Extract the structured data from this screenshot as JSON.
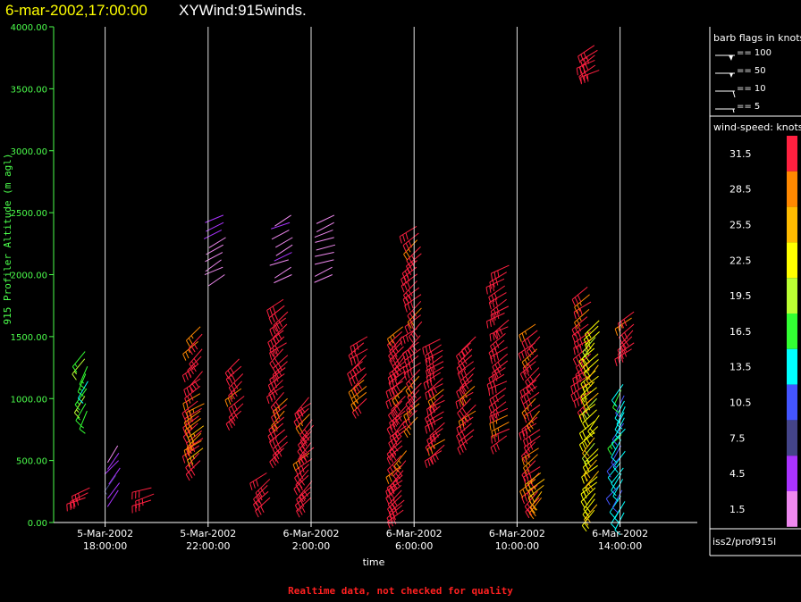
{
  "header": {
    "date": "6-mar-2002,17:00:00",
    "title": "XYWind:915winds."
  },
  "footer": {
    "note": "Realtime data, not checked for quality",
    "source": "iss2/prof915l"
  },
  "colors": {
    "background": "#000000",
    "axis_green": "#4cff4c",
    "title_yellow": "#ffff00",
    "note_red": "#ff2020",
    "gridline": "#e0e0e0"
  },
  "legend": {
    "barb_title": "barb flags in knots",
    "barbs": [
      {
        "label": "== 100"
      },
      {
        "label": "== 50"
      },
      {
        "label": "== 10"
      },
      {
        "label": "== 5"
      }
    ],
    "speed_title": "wind-speed: knots",
    "speed_levels": [
      {
        "value": "31.5",
        "color": "#ff2040"
      },
      {
        "value": "28.5",
        "color": "#ff8800"
      },
      {
        "value": "25.5",
        "color": "#ffbb00"
      },
      {
        "value": "22.5",
        "color": "#ffff00"
      },
      {
        "value": "19.5",
        "color": "#bbff33"
      },
      {
        "value": "16.5",
        "color": "#33ff33"
      },
      {
        "value": "13.5",
        "color": "#00ffff"
      },
      {
        "value": "10.5",
        "color": "#4455ff"
      },
      {
        "value": "7.5",
        "color": "#444488"
      },
      {
        "value": "4.5",
        "color": "#aa33ff"
      },
      {
        "value": "1.5",
        "color": "#ee88ee"
      }
    ]
  },
  "chart_data": {
    "type": "scatter",
    "title": "XYWind:915winds.",
    "xlabel": "time",
    "ylabel": "915 Profiler Altitude (m agl)",
    "ylim": [
      0,
      4000
    ],
    "xlim_hours_label": "5-Mar-2002 16:00 to 6-Mar-2002 17:00",
    "yticks": [
      "0.00",
      "500.00",
      "1000.00",
      "1500.00",
      "2000.00",
      "2500.00",
      "3000.00",
      "3500.00",
      "4000.00"
    ],
    "xticks": [
      {
        "date": "5-Mar-2002",
        "time": "18:00:00"
      },
      {
        "date": "5-Mar-2002",
        "time": "22:00:00"
      },
      {
        "date": "6-Mar-2002",
        "time": "2:00:00"
      },
      {
        "date": "6-Mar-2002",
        "time": "6:00:00"
      },
      {
        "date": "6-Mar-2002",
        "time": "10:00:00"
      },
      {
        "date": "6-Mar-2002",
        "time": "14:00:00"
      }
    ],
    "grid": "vertical lines at each x tick",
    "legend": "right",
    "series_note": "wind barbs colored by wind speed (knots)",
    "columns": [
      {
        "t": 17.3,
        "alts": [
          900,
          1380,
          60
        ],
        "speed": 16.5,
        "dir": 210
      },
      {
        "t": 17.3,
        "alts": [
          200,
          280,
          40
        ],
        "speed": 31.5,
        "dir": 250
      },
      {
        "t": 18.5,
        "alts": [
          260,
          640,
          60
        ],
        "speed": 4.5,
        "dir": 220
      },
      {
        "t": 19.8,
        "alts": [
          180,
          280,
          50
        ],
        "speed": 31.5,
        "dir": 250
      },
      {
        "t": 21.7,
        "alts": [
          500,
          1600,
          60
        ],
        "speed": 31.5,
        "dir": 230
      },
      {
        "t": 21.8,
        "alts": [
          600,
          1000,
          60
        ],
        "speed": 28.5,
        "dir": 235
      },
      {
        "t": 22.6,
        "alts": [
          2000,
          2520,
          60
        ],
        "speed": 1.5,
        "dir": 240
      },
      {
        "t": 23.3,
        "alts": [
          900,
          1350,
          60
        ],
        "speed": 31.5,
        "dir": 225
      },
      {
        "t": 24.3,
        "alts": [
          200,
          440,
          50
        ],
        "speed": 31.5,
        "dir": 235
      },
      {
        "t": 25.0,
        "alts": [
          600,
          1800,
          50
        ],
        "speed": 31.5,
        "dir": 230
      },
      {
        "t": 25.2,
        "alts": [
          2000,
          2480,
          60
        ],
        "speed": 1.5,
        "dir": 245
      },
      {
        "t": 26.0,
        "alts": [
          200,
          1030,
          45
        ],
        "speed": 31.5,
        "dir": 228
      },
      {
        "t": 26.9,
        "alts": [
          2000,
          2520,
          60
        ],
        "speed": 1.5,
        "dir": 250
      },
      {
        "t": 28.1,
        "alts": [
          1000,
          1520,
          50
        ],
        "speed": 31.5,
        "dir": 232
      },
      {
        "t": 29.6,
        "alts": [
          100,
          1600,
          40
        ],
        "speed": 31.5,
        "dir": 228
      },
      {
        "t": 30.2,
        "alts": [
          850,
          2400,
          55
        ],
        "speed": 31.5,
        "dir": 230
      },
      {
        "t": 31.1,
        "alts": [
          580,
          1500,
          45
        ],
        "speed": 31.5,
        "dir": 235
      },
      {
        "t": 32.3,
        "alts": [
          700,
          1520,
          50
        ],
        "speed": 31.5,
        "dir": 232
      },
      {
        "t": 33.6,
        "alts": [
          700,
          2100,
          55
        ],
        "speed": 31.5,
        "dir": 238
      },
      {
        "t": 34.8,
        "alts": [
          200,
          1620,
          50
        ],
        "speed": 31.5,
        "dir": 230
      },
      {
        "t": 35.0,
        "alts": [
          200,
          440,
          50
        ],
        "speed": 25.5,
        "dir": 225
      },
      {
        "t": 36.8,
        "alts": [
          1000,
          1900,
          60
        ],
        "speed": 31.5,
        "dir": 235
      },
      {
        "t": 37.1,
        "alts": [
          100,
          1650,
          45
        ],
        "speed": 22.5,
        "dir": 225
      },
      {
        "t": 37.1,
        "alts": [
          3650,
          3850,
          40
        ],
        "speed": 31.5,
        "dir": 240
      },
      {
        "t": 38.1,
        "alts": [
          80,
          1120,
          45
        ],
        "speed": 13.5,
        "dir": 215
      },
      {
        "t": 38.5,
        "alts": [
          1400,
          1700,
          50
        ],
        "speed": 31.5,
        "dir": 230
      }
    ]
  }
}
